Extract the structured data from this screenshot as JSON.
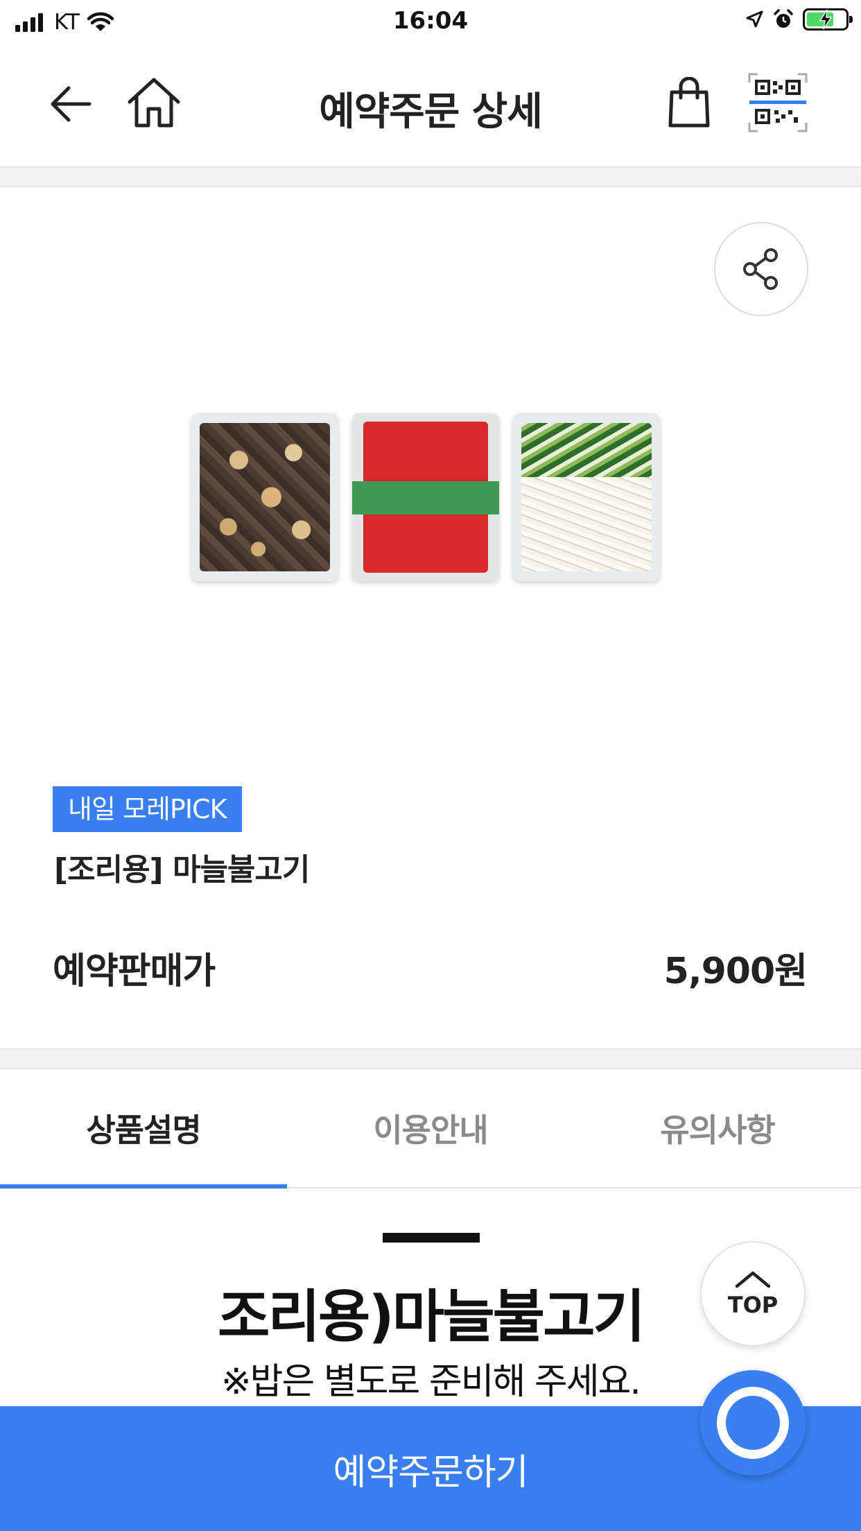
{
  "status_bar": {
    "carrier": "KT",
    "time": "16:04",
    "battery_level": 0.7,
    "battery_color": "#4cd964"
  },
  "header": {
    "title": "예약주문 상세",
    "icons": [
      "back-arrow-icon",
      "home-icon",
      "shopping-bag-icon",
      "qr-code-icon"
    ]
  },
  "product": {
    "badge": "내일 모레PICK",
    "name": "[조리용] 마늘불고기",
    "price_label": "예약판매가",
    "price": "5,900원",
    "image_icon": "product-photo-meat-sauce-vegetables"
  },
  "tabs": [
    {
      "label": "상품설명",
      "active": true
    },
    {
      "label": "이용안내",
      "active": false
    },
    {
      "label": "유의사항",
      "active": false
    }
  ],
  "description": {
    "title": "조리용)마늘불고기",
    "note": "※밥은 별도로 준비해 주세요."
  },
  "floating": {
    "top_label": "TOP"
  },
  "order_button": {
    "label": "예약주문하기"
  },
  "colors": {
    "accent": "#3a7ff2",
    "text": "#222222",
    "muted": "#8a8a8a"
  }
}
